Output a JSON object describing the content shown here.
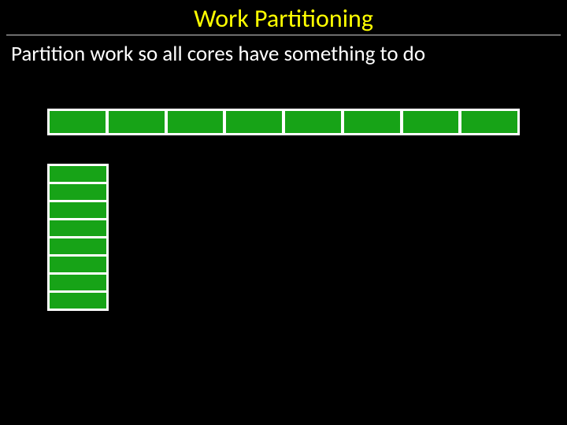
{
  "title": "Work Partitioning",
  "subtitle": "Partition work so all cores have something to do",
  "hcells": 8,
  "vcells": 8
}
